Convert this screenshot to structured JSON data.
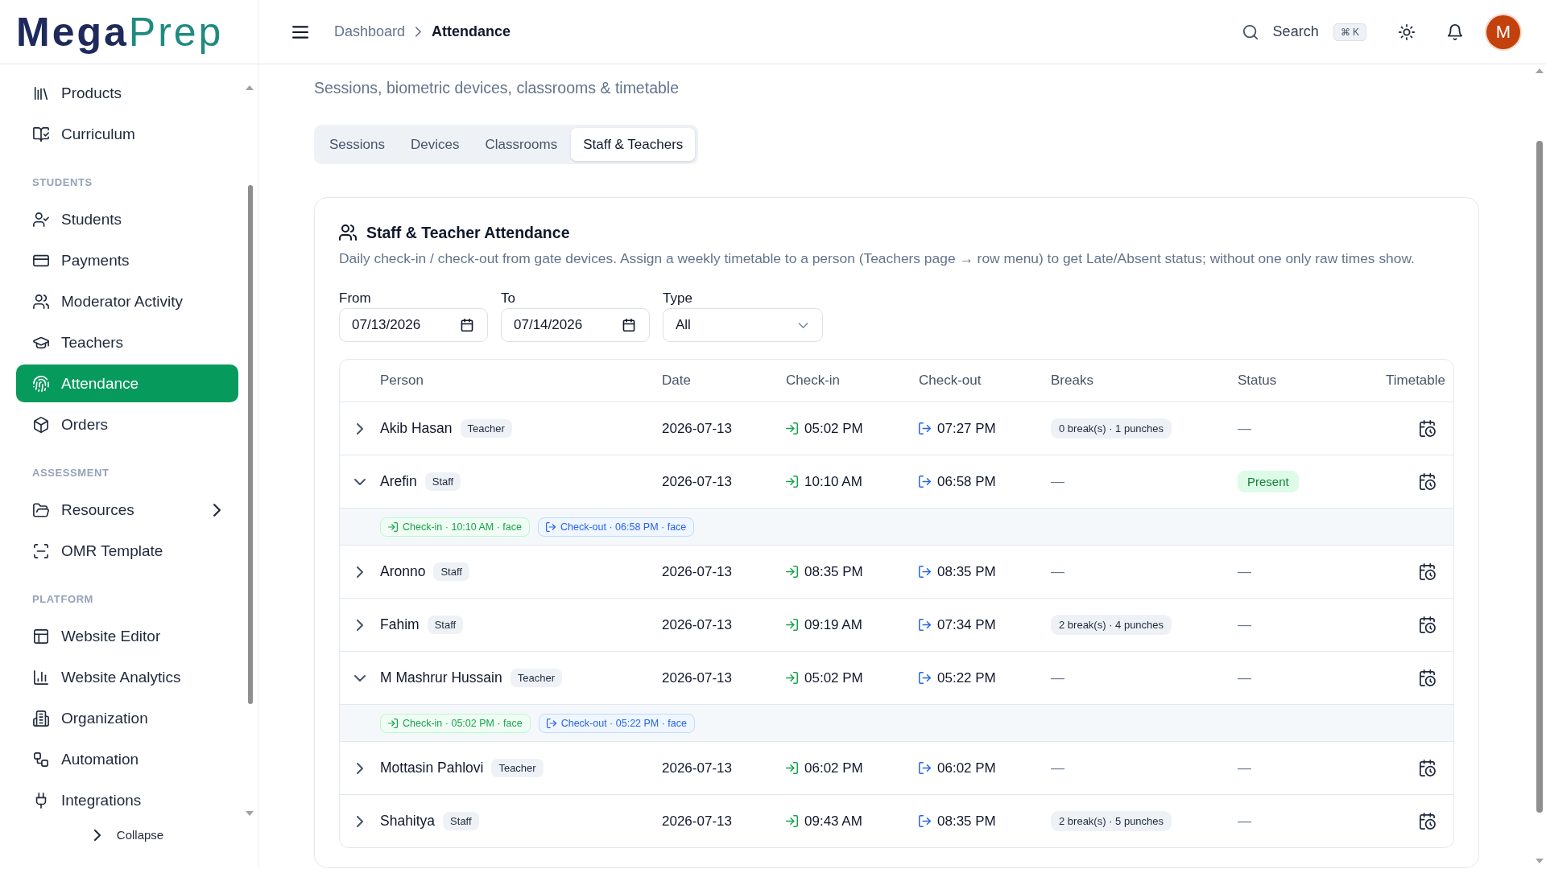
{
  "logo": {
    "primary": "Mega",
    "secondary": "Prep"
  },
  "sidebar": {
    "sections": [
      {
        "items": [
          {
            "label": "Products",
            "selected": false
          },
          {
            "label": "Curriculum",
            "selected": false
          }
        ]
      },
      {
        "heading": "STUDENTS",
        "items": [
          {
            "label": "Students",
            "selected": false
          },
          {
            "label": "Payments",
            "selected": false
          },
          {
            "label": "Moderator Activity",
            "selected": false
          },
          {
            "label": "Teachers",
            "selected": false
          },
          {
            "label": "Attendance",
            "selected": true
          },
          {
            "label": "Orders",
            "selected": false
          }
        ]
      },
      {
        "heading": "ASSESSMENT",
        "items": [
          {
            "label": "Resources",
            "selected": false,
            "expanded": false
          },
          {
            "label": "OMR Template",
            "selected": false
          }
        ]
      },
      {
        "heading": "PLATFORM",
        "items": [
          {
            "label": "Website Editor",
            "selected": false
          },
          {
            "label": "Website Analytics",
            "selected": false
          },
          {
            "label": "Organization",
            "selected": false
          },
          {
            "label": "Automation",
            "selected": false
          },
          {
            "label": "Integrations",
            "selected": false
          }
        ]
      }
    ],
    "collapse_label": "Collapse"
  },
  "header": {
    "breadcrumb": [
      {
        "label": "Dashboard",
        "current": false
      },
      {
        "label": "Attendance",
        "current": true
      }
    ],
    "search": {
      "label": "Search",
      "shortcut": "⌘ K"
    },
    "avatar": {
      "initial": "M"
    }
  },
  "page": {
    "subtitle": "Sessions, biometric devices, classrooms & timetable",
    "tabs": [
      {
        "label": "Sessions",
        "selected": false
      },
      {
        "label": "Devices",
        "selected": false
      },
      {
        "label": "Classrooms",
        "selected": false
      },
      {
        "label": "Staff & Teachers",
        "selected": true
      }
    ]
  },
  "card": {
    "title": "Staff & Teacher Attendance",
    "description": "Daily check-in / check-out from gate devices. Assign a weekly timetable to a person (Teachers page → row menu) to get Late/Absent status; without one only raw times show.",
    "filters": [
      {
        "kind": "date",
        "label": "From",
        "value": "07/13/2026"
      },
      {
        "kind": "date",
        "label": "To",
        "value": "07/14/2026"
      },
      {
        "kind": "select",
        "label": "Type",
        "value": "All"
      }
    ],
    "table": {
      "columns": [
        "Person",
        "Date",
        "Check-in",
        "Check-out",
        "Breaks",
        "Status",
        "Timetable"
      ],
      "rows": [
        {
          "person": "Akib Hasan",
          "role": "Teacher",
          "date": "2026-07-13",
          "check_in": "05:02 PM",
          "check_out": "07:27 PM",
          "breaks": {
            "kind": "summary",
            "text": "0 break(s) · 1 punches"
          },
          "status": {
            "kind": "none",
            "text": "—"
          },
          "expanded": false
        },
        {
          "person": "Arefin",
          "role": "Staff",
          "date": "2026-07-13",
          "check_in": "10:10 AM",
          "check_out": "06:58 PM",
          "breaks": {
            "kind": "none",
            "text": "—"
          },
          "status": {
            "kind": "present",
            "text": "Present"
          },
          "expanded": true,
          "punches": [
            {
              "kind": "check_in",
              "text": "Check-in · 10:10 AM · face"
            },
            {
              "kind": "check_out",
              "text": "Check-out · 06:58 PM · face"
            }
          ]
        },
        {
          "person": "Aronno",
          "role": "Staff",
          "date": "2026-07-13",
          "check_in": "08:35 PM",
          "check_out": "08:35 PM",
          "breaks": {
            "kind": "none",
            "text": "—"
          },
          "status": {
            "kind": "none",
            "text": "—"
          },
          "expanded": false
        },
        {
          "person": "Fahim",
          "role": "Staff",
          "date": "2026-07-13",
          "check_in": "09:19 AM",
          "check_out": "07:34 PM",
          "breaks": {
            "kind": "summary",
            "text": "2 break(s) · 4 punches"
          },
          "status": {
            "kind": "none",
            "text": "—"
          },
          "expanded": false
        },
        {
          "person": "M Mashrur Hussain",
          "role": "Teacher",
          "date": "2026-07-13",
          "check_in": "05:02 PM",
          "check_out": "05:22 PM",
          "breaks": {
            "kind": "none",
            "text": "—"
          },
          "status": {
            "kind": "none",
            "text": "—"
          },
          "expanded": true,
          "punches": [
            {
              "kind": "check_in",
              "text": "Check-in · 05:02 PM · face"
            },
            {
              "kind": "check_out",
              "text": "Check-out · 05:22 PM · face"
            }
          ]
        },
        {
          "person": "Mottasin Pahlovi",
          "role": "Teacher",
          "date": "2026-07-13",
          "check_in": "06:02 PM",
          "check_out": "06:02 PM",
          "breaks": {
            "kind": "none",
            "text": "—"
          },
          "status": {
            "kind": "none",
            "text": "—"
          },
          "expanded": false
        },
        {
          "person": "Shahitya",
          "role": "Staff",
          "date": "2026-07-13",
          "check_in": "09:43 AM",
          "check_out": "08:35 PM",
          "breaks": {
            "kind": "summary",
            "text": "2 break(s) · 5 punches"
          },
          "status": {
            "kind": "none",
            "text": "—"
          },
          "expanded": false
        }
      ]
    }
  }
}
